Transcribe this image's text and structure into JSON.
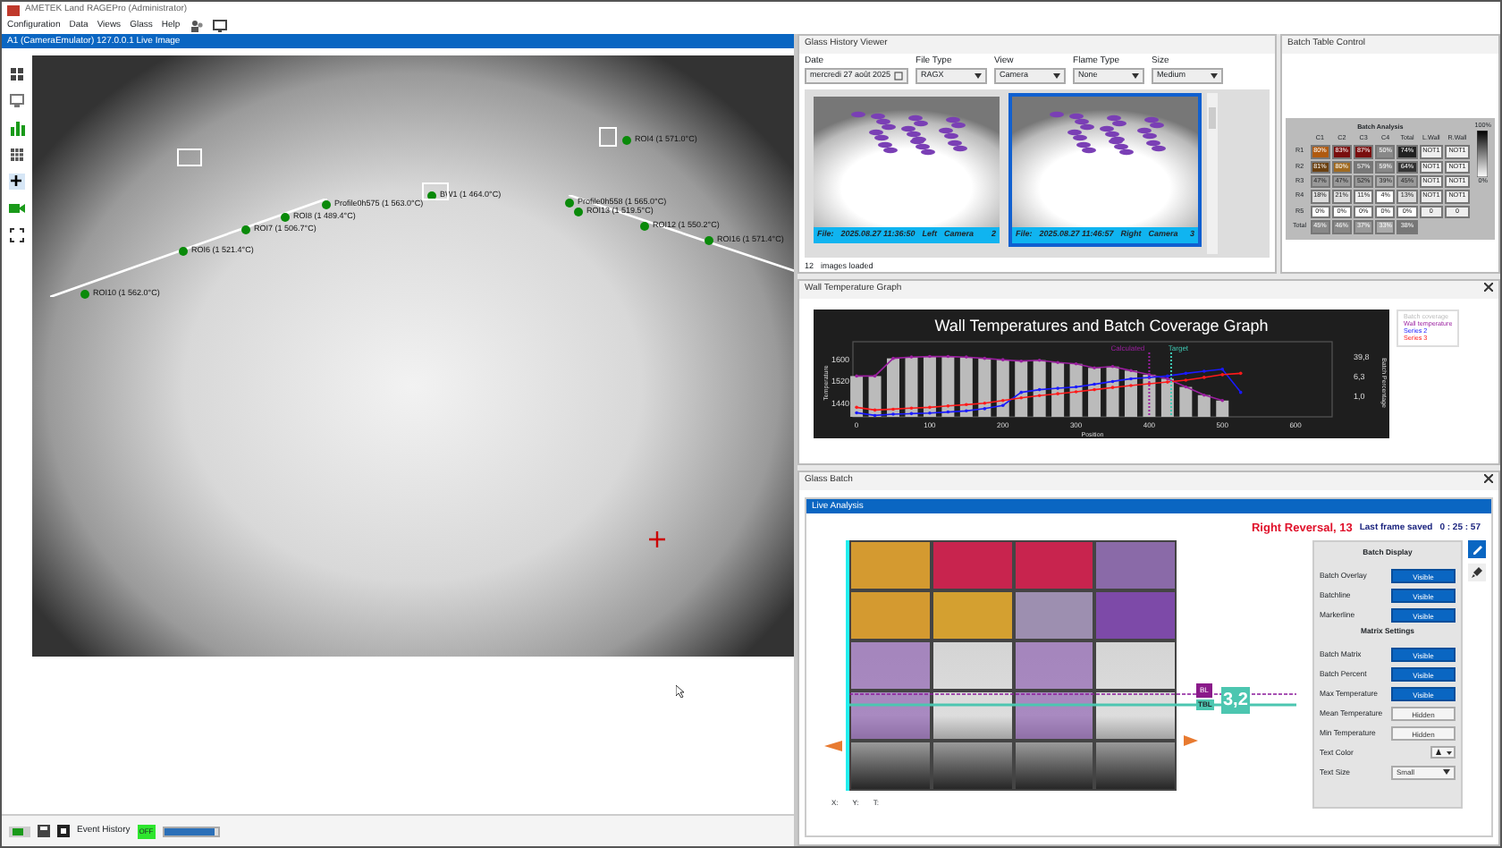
{
  "window": {
    "title": "AMETEK Land RAGEPro (Administrator)"
  },
  "menu": [
    "Configuration",
    "Data",
    "Views",
    "Glass",
    "Help"
  ],
  "live_image": {
    "title": "A1 (CameraEmulator) 127.0.0.1 Live Image",
    "rois": [
      {
        "label": "ROI10 (1 562.0°C)"
      },
      {
        "label": "ROI6 (1 521.4°C)"
      },
      {
        "label": "ROI7 (1 506.7°C)"
      },
      {
        "label": "ROI8 (1 489.4°C)"
      },
      {
        "label": "Profile0h575 (1 563.0°C)"
      },
      {
        "label": "BW1 (1 464.0°C)"
      },
      {
        "label": "Profile0h558 (1 565.0°C)"
      },
      {
        "label": "ROI13 (1 519.5°C)"
      },
      {
        "label": "ROI12 (1 550.2°C)"
      },
      {
        "label": "ROI16 (1 571.4°C)"
      },
      {
        "label": "ROI4 (1 571.0°C)"
      }
    ]
  },
  "glass_history_viewer": {
    "title": "Glass History Viewer",
    "filters": [
      {
        "label": "Date",
        "value": "mercredi 27 août 2025"
      },
      {
        "label": "File Type",
        "value": "RAGX"
      },
      {
        "label": "View",
        "value": "Camera"
      },
      {
        "label": "Flame Type",
        "value": "None"
      },
      {
        "label": "Size",
        "value": "Medium"
      }
    ],
    "images": [
      {
        "file_label": "File:",
        "timestamp": "2025.08.27 11:36:50",
        "side": "Left",
        "view": "Camera",
        "number": "2",
        "selected": false
      },
      {
        "file_label": "File:",
        "timestamp": "2025.08.27 11:46:57",
        "side": "Right",
        "view": "Camera",
        "number": "3",
        "selected": true
      }
    ],
    "count": "12",
    "status": "images loaded"
  },
  "batch_table_control": {
    "title": "Batch Table Control",
    "table_title": "Batch Analysis",
    "columns": [
      "C1",
      "C2",
      "C3",
      "C4",
      "Total",
      "L.Wall",
      "R.Wall"
    ],
    "rows": [
      {
        "label": "R1",
        "cells": [
          "80%",
          "83%",
          "87%",
          "50%",
          "74%",
          "NOT1",
          "NOT1"
        ]
      },
      {
        "label": "R2",
        "cells": [
          "81%",
          "80%",
          "57%",
          "59%",
          "64%",
          "NOT1",
          "NOT1"
        ]
      },
      {
        "label": "R3",
        "cells": [
          "47%",
          "47%",
          "52%",
          "39%",
          "45%",
          "NOT1",
          "NOT1"
        ]
      },
      {
        "label": "R4",
        "cells": [
          "18%",
          "21%",
          "11%",
          "4%",
          "13%",
          "NOT1",
          "NOT1"
        ]
      },
      {
        "label": "R5",
        "cells": [
          "0%",
          "0%",
          "0%",
          "0%",
          "0%",
          "0",
          "0"
        ]
      },
      {
        "label": "Total",
        "cells": [
          "45%",
          "46%",
          "37%",
          "33%",
          "38%"
        ]
      }
    ],
    "scale_max": "100%",
    "scale_min": "0%"
  },
  "wall_temperature_graph": {
    "title": "Wall Temperature Graph",
    "right_axis_title": "Batch Percentage",
    "right_axis_labels": [
      "39,8",
      "6,3",
      "1,0"
    ],
    "chart_data": {
      "type": "line",
      "title": "Wall Temperatures and Batch Coverage Graph",
      "xlabel": "Position",
      "ylabel": "Temperature",
      "x": [
        0,
        25,
        50,
        75,
        100,
        125,
        150,
        175,
        200,
        225,
        250,
        275,
        300,
        325,
        350,
        375,
        400,
        425,
        450,
        475,
        500,
        525
      ],
      "series": [
        {
          "name": "Batch coverage",
          "color": "#bbbbbb",
          "type": "bar",
          "values": [
            1540,
            1540,
            1605,
            1610,
            1612,
            1612,
            1610,
            1605,
            1600,
            1595,
            1598,
            1590,
            1585,
            1570,
            1575,
            1560,
            1545,
            1530,
            1500,
            1470,
            1450,
            null
          ]
        },
        {
          "name": "Wall temperature",
          "color": "#9b1fa0",
          "marker": true,
          "values": [
            1540,
            1540,
            1605,
            1610,
            1612,
            1612,
            1610,
            1605,
            1600,
            1595,
            1598,
            1590,
            1585,
            1570,
            1575,
            1560,
            1545,
            1530,
            1500,
            1470,
            1450,
            null
          ]
        },
        {
          "name": "Series 2",
          "color": "#1a1aff",
          "marker": true,
          "values": [
            1405,
            1395,
            1400,
            1402,
            1404,
            1408,
            1412,
            1420,
            1432,
            1480,
            1490,
            1495,
            1500,
            1510,
            1520,
            1530,
            1535,
            1540,
            1550,
            1558,
            1565,
            1480
          ]
        },
        {
          "name": "Series 3",
          "color": "#ff1a1a",
          "marker": true,
          "values": [
            1425,
            1415,
            1418,
            1422,
            1425,
            1430,
            1435,
            1440,
            1450,
            1460,
            1468,
            1475,
            1482,
            1490,
            1498,
            1505,
            1512,
            1518,
            1525,
            1535,
            1545,
            1550
          ]
        }
      ],
      "xlim": [
        -5,
        650
      ],
      "ylim": [
        1390,
        1640
      ],
      "xticks": [
        0,
        100,
        200,
        300,
        400,
        500,
        600
      ],
      "yticks": [
        1440,
        1520,
        1600
      ],
      "annotations": [
        "Calculated",
        "Target"
      ]
    }
  },
  "glass_batch": {
    "title": "Glass Batch",
    "tab": "Live Analysis",
    "reversal": "Right Reversal,  13",
    "last_frame_label": "Last frame saved",
    "elapsed": "0 : 25 : 57",
    "settings": [
      {
        "kind": "heading",
        "label": "Batch Display"
      },
      {
        "kind": "toggle",
        "label": "Batch Overlay",
        "value": "Visible",
        "on": true
      },
      {
        "kind": "toggle",
        "label": "Batchline",
        "value": "Visible",
        "on": true
      },
      {
        "kind": "toggle",
        "label": "Markerline",
        "value": "Visible",
        "on": true
      },
      {
        "kind": "heading",
        "label": "Matrix Settings"
      },
      {
        "kind": "toggle",
        "label": "Batch Matrix",
        "value": "Visible",
        "on": true
      },
      {
        "kind": "toggle",
        "label": "Batch Percent",
        "value": "Visible",
        "on": true
      },
      {
        "kind": "toggle",
        "label": "Max Temperature",
        "value": "Visible",
        "on": true
      },
      {
        "kind": "toggle",
        "label": "Mean Temperature",
        "value": "Hidden",
        "on": false
      },
      {
        "kind": "toggle",
        "label": "Min Temperature",
        "value": "Hidden",
        "on": false
      },
      {
        "kind": "color",
        "label": "Text Color"
      },
      {
        "kind": "select",
        "label": "Text Size",
        "value": "Small"
      }
    ],
    "bl_label": "BL",
    "tbl_label": "TBL",
    "marker_value": "3,2",
    "coords": [
      "X:",
      "Y:",
      "T:"
    ]
  },
  "status_bar": {
    "event_history": "Event History",
    "indicator": "OFF",
    "progress": {
      "level": 0.93
    }
  }
}
